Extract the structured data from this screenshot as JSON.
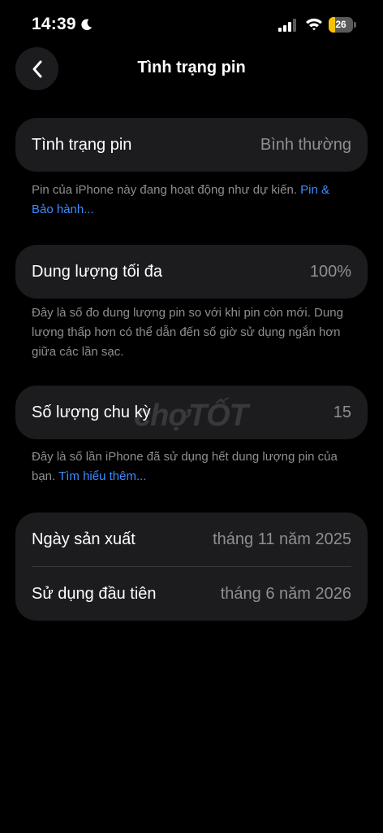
{
  "status_bar": {
    "time": "14:39",
    "battery_level": "26",
    "battery_fraction": 0.26,
    "icons": [
      "moon-icon",
      "signal-icon",
      "wifi-icon",
      "battery-icon"
    ]
  },
  "nav": {
    "title": "Tình trạng pin",
    "back_icon": "chevron-left-icon"
  },
  "health": {
    "label": "Tình trạng pin",
    "value": "Bình thường",
    "note": "Pin của iPhone này đang hoạt động như dự kiến. ",
    "link": "Pin & Bảo hành..."
  },
  "capacity": {
    "label": "Dung lượng tối đa",
    "value": "100%",
    "note": "Đây là số đo dung lượng pin so với khi pin còn mới. Dung lượng thấp hơn có thể dẫn đến số giờ sử dụng ngắn hơn giữa các lần sạc."
  },
  "cycles": {
    "label": "Số lượng chu kỳ",
    "value": "15",
    "note": "Đây là số lần iPhone đã sử dụng hết dung lượng pin của bạn. ",
    "link": "Tìm hiểu thêm..."
  },
  "dates": {
    "manufacture_label": "Ngày sản xuất",
    "manufacture_value": "tháng 11 năm 2025",
    "first_use_label": "Sử dụng đầu tiên",
    "first_use_value": "tháng 6 năm 2026"
  },
  "watermark": "chợTỐT",
  "colors": {
    "background": "#000000",
    "card": "#1c1c1e",
    "secondary_text": "#8e8e93",
    "link": "#3d8bff",
    "battery_fill": "#f5c400"
  }
}
